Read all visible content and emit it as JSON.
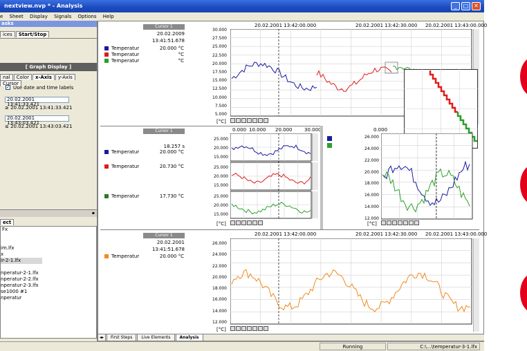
{
  "window": {
    "title": "nextview.nvp * - Analysis",
    "buttons": [
      "_",
      "□",
      "✕"
    ]
  },
  "menu": [
    "e",
    "Sheet",
    "Display",
    "Signals",
    "Options",
    "Help"
  ],
  "left": {
    "tasks_label": "asks",
    "tabs_top": [
      "ices",
      "Start/Stop"
    ],
    "graph_display": "[ Graph Display ]",
    "tabs_axis": [
      "nal",
      "Color",
      "x-Axis",
      "y-Axis",
      "Cursor"
    ],
    "checkbox_label": "Use date and time labels",
    "from_value": "20.02.2001 13:41:33.421",
    "from_ge": "≥ 20.02.2001 13:41:33.421",
    "to_value": "20.02.2001 13:43:03.421",
    "to_le": "≤ 20.02.2001 13:43:03.421",
    "bottom_tab": "ect",
    "files": [
      "Fx",
      "",
      "",
      "im.lfx",
      "x",
      "ir-2-1.lfx",
      "",
      "nperatur-2-1.lfx",
      "nperatur-2-2.lfx",
      "nperatur-2-3.lfx",
      "se1000 #1",
      "nperatur"
    ]
  },
  "top": {
    "cursor": "Cursor 1",
    "date": "20.02.2009",
    "time": "13:41:51.678",
    "legend": [
      {
        "name": "Temperatur",
        "value": "20.000 °C",
        "color": "#1a1aa0"
      },
      {
        "name": "Temperatur",
        "value": "°C",
        "color": "#e31a1a"
      },
      {
        "name": "Temperatur",
        "value": "°C",
        "color": "#2aa02a"
      }
    ],
    "xticks": [
      "20.02.2001 13:42:00.000",
      "20.02.2001 13:42:30.000",
      "20.02.2001 13:43:00.000"
    ],
    "yticks": [
      "30.000",
      "27.500",
      "25.000",
      "22.500",
      "20.000",
      "17.500",
      "15.000",
      "12.500",
      "10.000",
      "7.500",
      "5.000"
    ],
    "unit": "[°C]"
  },
  "mid": {
    "cursor": "Cursor 1",
    "seconds": "18.257 s",
    "legend": [
      {
        "name": "Temperatur",
        "value": "20.000 °C",
        "color": "#1a1aa0"
      },
      {
        "name": "Temperatur",
        "value": "20.730 °C",
        "color": "#e31a1a"
      },
      {
        "name": "Temperatur",
        "value": "17.730 °C",
        "color": "#2a7a2a"
      }
    ],
    "xticks": [
      "0.000",
      "10.000",
      "20.000",
      "30.000"
    ],
    "yticks_a": [
      "25.000",
      "20.000",
      "15.000"
    ],
    "yticks_b": [
      "25.000",
      "20.000",
      "15.000"
    ],
    "yticks_c": [
      "25.000",
      "20.000",
      "15.000"
    ],
    "unit": "[°C]"
  },
  "xy": {
    "xtick": "0.000",
    "yticks": [
      "26.000",
      "24.000",
      "22.000",
      "20.000",
      "18.000",
      "16.000",
      "14.000",
      "12.000"
    ],
    "unit": "[°C]"
  },
  "bottom": {
    "cursor": "Cursor 1",
    "date": "20.02.2001",
    "time": "13:41:51.678",
    "legend": [
      {
        "name": "Temperatur",
        "value": "20.000 °C",
        "color": "#f08a1e"
      }
    ],
    "xticks": [
      "20.02.2001 13:42:00.000",
      "20.02.2001 13:42:30.000",
      "20.02.2001 13:43:00.000"
    ],
    "yticks": [
      "26.000",
      "24.000",
      "22.000",
      "20.000",
      "18.000",
      "16.000",
      "14.000",
      "12.000"
    ],
    "unit": "[°C]"
  },
  "sheets": [
    "First Steps",
    "Live Elements",
    "Analysis"
  ],
  "status": {
    "running": "Running",
    "path": "C:\\...\\temperatur-3-1.lfx"
  },
  "colors": {
    "blue": "#1a1aa0",
    "red": "#e31a1a",
    "green": "#2aa02a",
    "orange": "#f08a1e",
    "accent": "#e3001b"
  }
}
